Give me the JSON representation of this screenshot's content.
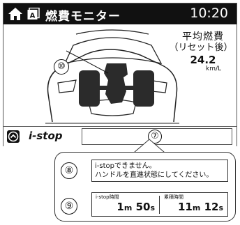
{
  "header": {
    "title": "燃費モニター",
    "clock": "10:20"
  },
  "average": {
    "title": "平均燃費",
    "subtitle": "（リセット後）",
    "value": "24.2",
    "unit": "km/L"
  },
  "callouts": {
    "c7": "⑦",
    "c8": "⑧",
    "c9": "⑨",
    "c10": "⑩"
  },
  "istop": {
    "label": "i-stop"
  },
  "message": {
    "line1": "i-stopできません。",
    "line2": "ハンドルを直進状態にしてください。"
  },
  "timers": {
    "stop_label": "i-stop時間",
    "stop_min": "1",
    "stop_min_unit": "m",
    "stop_sec": "50",
    "stop_sec_unit": "s",
    "total_label": "累積時間",
    "total_min": "11",
    "total_min_unit": "m",
    "total_sec": "12",
    "total_sec_unit": "s"
  },
  "icons": [
    "home-icon",
    "auto-icon",
    "chevron-up-icon"
  ]
}
